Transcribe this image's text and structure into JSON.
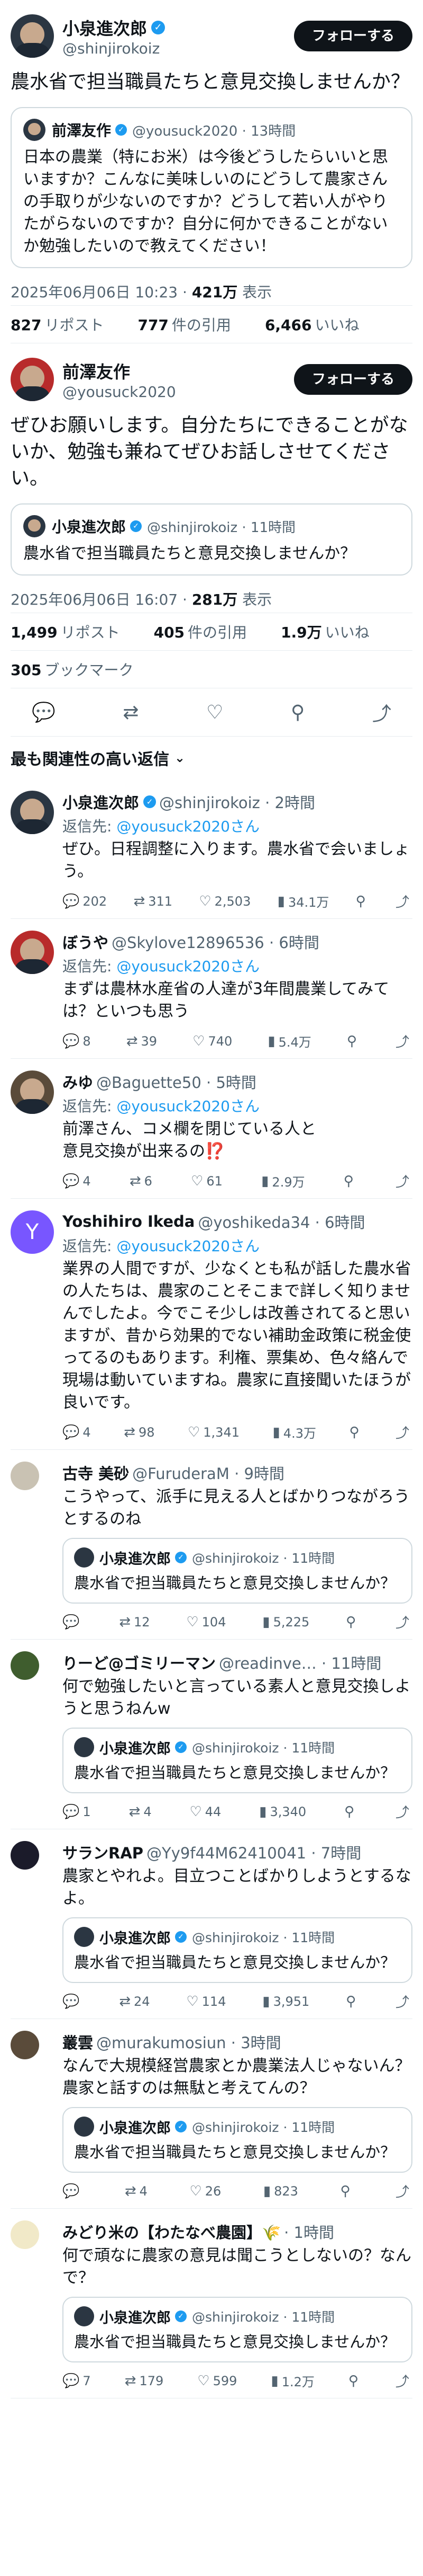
{
  "main_post": {
    "name": "小泉進次郎",
    "handle": "@shinjirokoiz",
    "follow": "フォローする",
    "text": "農水省で担当職員たちと意見交換しませんか？",
    "quote": {
      "name": "前澤友作",
      "meta": "@yousuck2020 · 13時間",
      "text": "日本の農業（特にお米）は今後どうしたらいいと思いますか？こんなに美味しいのにどうして農家さんの手取りが少ないのですか？どうして若い人がやりたがらないのですか？自分に何かできることがないか勉強したいので教えてください！"
    },
    "datetime": "2025年06月06日 10:23 · ",
    "views": "421万",
    "views_label": " 表示",
    "reposts": "827",
    "reposts_label": "リポスト",
    "quotes": "777",
    "quotes_label": "件の引用",
    "likes": "6,466",
    "likes_label": "いいね"
  },
  "second_post": {
    "name": "前澤友作",
    "handle": "@yousuck2020",
    "follow": "フォローする",
    "text": "ぜひお願いします。自分たちにできることがないか、勉強も兼ねてぜひお話しさせてください。",
    "quote": {
      "name": "小泉進次郎",
      "meta": "@shinjirokoiz · 11時間",
      "text": "農水省で担当職員たちと意見交換しませんか？"
    },
    "datetime": "2025年06月06日 16:07 · ",
    "views": "281万",
    "views_label": " 表示",
    "reposts": "1,499",
    "reposts_label": "リポスト",
    "quotes": "405",
    "quotes_label": "件の引用",
    "likes": "1.9万",
    "likes_label": "いいね",
    "bookmarks": "305",
    "bookmarks_label": "ブックマーク"
  },
  "sort_label": "最も関連性の高い返信",
  "replies": [
    {
      "name": "小泉進次郎",
      "handle": "@shinjirokoiz · 2時間",
      "reply_to_label": "返信先: ",
      "reply_to": "@yousuck2020さん",
      "text": "ぜひ。日程調整に入ります。農水省で会いましょう。",
      "replies": "202",
      "reposts": "311",
      "likes": "2,503",
      "views": "34.1万"
    },
    {
      "name": "ぼうや",
      "handle": "@Skylove12896536 · 6時間",
      "reply_to_label": "返信先: ",
      "reply_to": "@yousuck2020さん",
      "text": "まずは農林水産省の人達が3年間農業してみては？といつも思う",
      "replies": "8",
      "reposts": "39",
      "likes": "740",
      "views": "5.4万"
    },
    {
      "name": "みゆ",
      "handle": "@Baguette50 · 5時間",
      "reply_to_label": "返信先: ",
      "reply_to": "@yousuck2020さん",
      "text": "前澤さん、コメ欄を閉じている人と\n意見交換が出来るの⁉️",
      "replies": "4",
      "reposts": "6",
      "likes": "61",
      "views": "2.9万"
    },
    {
      "name": "Yoshihiro Ikeda",
      "handle": "@yoshikeda34 · 6時間",
      "reply_to_label": "返信先: ",
      "reply_to": "@yousuck2020さん",
      "text": "業界の人間ですが、少なくとも私が話した農水省の人たちは、農家のことそこまで詳しく知りませんでしたよ。今でこそ少しは改善されてると思いますが、昔から効果的でない補助金政策に税金使ってるのもあります。利権、票集め、色々絡んで現場は動いていますね。農家に直接聞いたほうが良いです。",
      "replies": "4",
      "reposts": "98",
      "likes": "1,341",
      "views": "4.3万"
    }
  ],
  "quote_replies": [
    {
      "name": "古寺 美砂",
      "handle": "@FuruderaM · 9時間",
      "text": "こうやって、派手に見える人とばかりつながろうとするのね",
      "quote_name": "小泉進次郎",
      "quote_meta": "@shinjirokoiz · 11時間",
      "quote_text": "農水省で担当職員たちと意見交換しませんか？",
      "replies": "",
      "reposts": "12",
      "likes": "104",
      "views": "5,225"
    },
    {
      "name": "りーど@ゴミリーマン",
      "handle": "@readinve… · 11時間",
      "text": "何で勉強したいと言っている素人と意見交換しようと思うねんw",
      "quote_name": "小泉進次郎",
      "quote_meta": "@shinjirokoiz · 11時間",
      "quote_text": "農水省で担当職員たちと意見交換しませんか？",
      "replies": "1",
      "reposts": "4",
      "likes": "44",
      "views": "3,340"
    },
    {
      "name": "サランRAP",
      "handle": "@Yy9f44M62410041 · 7時間",
      "text": "農家とやれよ。目立つことばかりしようとするなよ。",
      "quote_name": "小泉進次郎",
      "quote_meta": "@shinjirokoiz · 11時間",
      "quote_text": "農水省で担当職員たちと意見交換しませんか？",
      "replies": "",
      "reposts": "24",
      "likes": "114",
      "views": "3,951"
    },
    {
      "name": "叢雲",
      "handle": "@murakumosiun · 3時間",
      "text": "なんで大規模経営農家とか農業法人じゃないん？\n農家と話すのは無駄と考えてんの？",
      "quote_name": "小泉進次郎",
      "quote_meta": "@shinjirokoiz · 11時間",
      "quote_text": "農水省で担当職員たちと意見交換しませんか？",
      "replies": "",
      "reposts": "4",
      "likes": "26",
      "views": "823"
    },
    {
      "name": "みどり米の【わたなべ農園】🌾",
      "handle": "· 1時間",
      "text": "何で頑なに農家の意見は聞こうとしないの？なんで？",
      "quote_name": "小泉進次郎",
      "quote_meta": "@shinjirokoiz · 11時間",
      "quote_text": "農水省で担当職員たちと意見交換しませんか？",
      "replies": "7",
      "reposts": "179",
      "likes": "599",
      "views": "1.2万"
    }
  ],
  "icons": {
    "reply": "💬",
    "repost": "⇄",
    "like": "♡",
    "views": "▮",
    "bookmark": "⚲",
    "share": "⤴"
  }
}
